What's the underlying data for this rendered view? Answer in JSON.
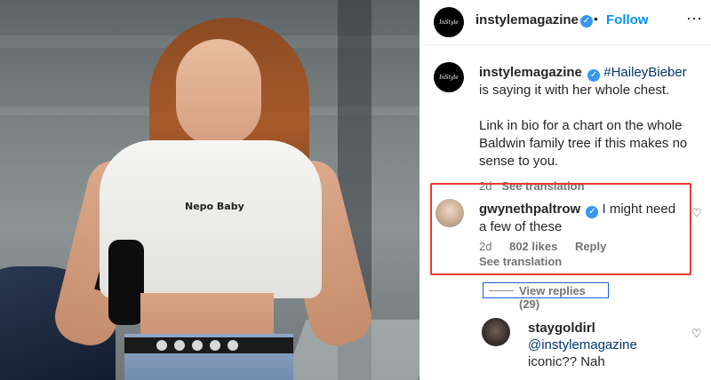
{
  "post": {
    "photo": {
      "shirt_text": "Nepo Baby"
    },
    "header": {
      "avatar_text": "InStyle",
      "username": "instylemagazine",
      "verified_glyph": "✓",
      "separator": "•",
      "follow_label": "Follow",
      "more_icon": "⋯"
    },
    "caption": {
      "username": "instylemagazine",
      "hashtag": "#HaileyBieber",
      "text_line1": " is saying it with her whole chest.",
      "text_para2": "Link in bio for a chart on the whole Baldwin family tree if this makes no sense to you.",
      "time": "2d",
      "see_translation": "See translation"
    },
    "comment": {
      "username": "gwynethpaltrow",
      "text": " I might need a few of these",
      "time": "2d",
      "likes": "802 likes",
      "reply_label": "Reply",
      "see_translation": "See translation",
      "heart_icon": "♡"
    },
    "view_replies": "View replies (29)",
    "reply": {
      "username": "staygoldirl",
      "mention": "@instylemagazine",
      "text": "iconic?? Nah",
      "heart_icon": "♡"
    },
    "colors": {
      "accent": "#0095f6",
      "verified": "#3897f0",
      "highlight_box": "#e53935",
      "replies_box": "#1e5fd6"
    }
  }
}
